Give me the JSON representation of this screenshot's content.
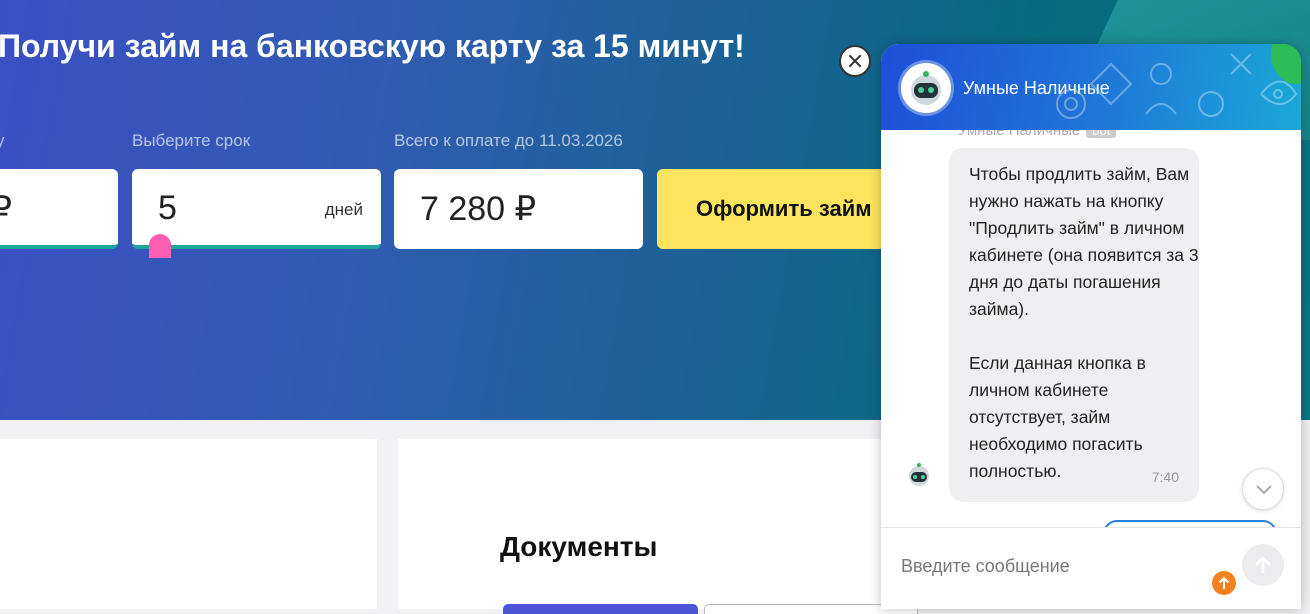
{
  "hero": {
    "title": "Получи займ на банковскую карту за 15 минут!",
    "amount_label": "у",
    "amount_value": "₽",
    "term_label": "Выберите срок",
    "term_value": "5",
    "term_unit": "дней",
    "total_label": "Всего к оплате до 11.03.2026",
    "total_value": "7 280 ₽",
    "apply_label": "Оформить займ"
  },
  "docs": {
    "title": "Документы"
  },
  "chat": {
    "title": "Умные Наличные",
    "sender": "Умные Наличные",
    "bot_tag": "bot",
    "message": "Чтобы продлить займ, Вам нужно нажать на кнопку \"Продлить займ\" в личном кабинете (она появится за 3 дня до даты погашения займа).\n\nЕсли данная кнопка в личном кабинете отсутствует, займ необходимо погасить полностью.",
    "time": "7:40",
    "input_placeholder": "Введите сообщение"
  },
  "colors": {
    "accent_yellow": "#fce45f",
    "slider_pink": "#ff5fb0",
    "underline_teal": "#1ca79b",
    "upload_orange": "#f5821f"
  }
}
